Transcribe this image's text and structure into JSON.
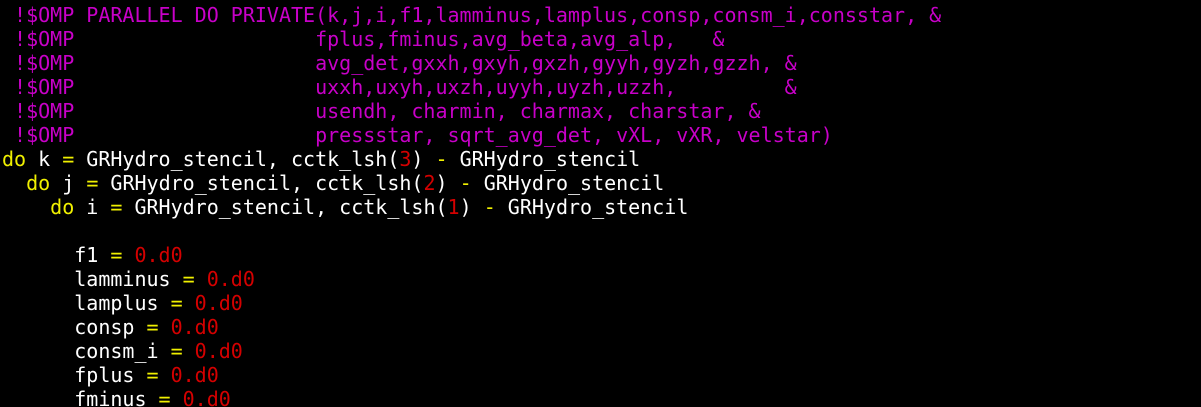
{
  "colors": {
    "background": "#000000",
    "comment": "#c800c8",
    "keyword": "#f0f000",
    "operator": "#f0f000",
    "text": "#ffffff",
    "number": "#d40000"
  },
  "lines": [
    [
      {
        "text": " !$OMP PARALLEL DO PRIVATE(k,j,i,f1,lamminus,lamplus,consp,consm_i,consstar, &",
        "role": "comment"
      }
    ],
    [
      {
        "text": " !$OMP                    fplus,fminus,avg_beta,avg_alp,   &",
        "role": "comment"
      }
    ],
    [
      {
        "text": " !$OMP                    avg_det,gxxh,gxyh,gxzh,gyyh,gyzh,gzzh, &",
        "role": "comment"
      }
    ],
    [
      {
        "text": " !$OMP                    uxxh,uxyh,uxzh,uyyh,uyzh,uzzh,         &",
        "role": "comment"
      }
    ],
    [
      {
        "text": " !$OMP                    usendh, charmin, charmax, charstar, &",
        "role": "comment"
      }
    ],
    [
      {
        "text": " !$OMP                    pressstar, sqrt_avg_det, vXL, vXR, velstar)",
        "role": "comment"
      }
    ],
    [
      {
        "text": "do",
        "role": "keyword"
      },
      {
        "text": " k ",
        "role": "text"
      },
      {
        "text": "=",
        "role": "operator"
      },
      {
        "text": " GRHydro_stencil, cctk_lsh(",
        "role": "text"
      },
      {
        "text": "3",
        "role": "number"
      },
      {
        "text": ") ",
        "role": "text"
      },
      {
        "text": "-",
        "role": "operator"
      },
      {
        "text": " GRHydro_stencil",
        "role": "text"
      }
    ],
    [
      {
        "text": "  ",
        "role": "text"
      },
      {
        "text": "do",
        "role": "keyword"
      },
      {
        "text": " j ",
        "role": "text"
      },
      {
        "text": "=",
        "role": "operator"
      },
      {
        "text": " GRHydro_stencil, cctk_lsh(",
        "role": "text"
      },
      {
        "text": "2",
        "role": "number"
      },
      {
        "text": ") ",
        "role": "text"
      },
      {
        "text": "-",
        "role": "operator"
      },
      {
        "text": " GRHydro_stencil",
        "role": "text"
      }
    ],
    [
      {
        "text": "    ",
        "role": "text"
      },
      {
        "text": "do",
        "role": "keyword"
      },
      {
        "text": " i ",
        "role": "text"
      },
      {
        "text": "=",
        "role": "operator"
      },
      {
        "text": " GRHydro_stencil, cctk_lsh(",
        "role": "text"
      },
      {
        "text": "1",
        "role": "number"
      },
      {
        "text": ") ",
        "role": "text"
      },
      {
        "text": "-",
        "role": "operator"
      },
      {
        "text": " GRHydro_stencil",
        "role": "text"
      }
    ],
    [],
    [
      {
        "text": "      f1 ",
        "role": "text"
      },
      {
        "text": "=",
        "role": "operator"
      },
      {
        "text": " ",
        "role": "text"
      },
      {
        "text": "0.d0",
        "role": "number"
      }
    ],
    [
      {
        "text": "      lamminus ",
        "role": "text"
      },
      {
        "text": "=",
        "role": "operator"
      },
      {
        "text": " ",
        "role": "text"
      },
      {
        "text": "0.d0",
        "role": "number"
      }
    ],
    [
      {
        "text": "      lamplus ",
        "role": "text"
      },
      {
        "text": "=",
        "role": "operator"
      },
      {
        "text": " ",
        "role": "text"
      },
      {
        "text": "0.d0",
        "role": "number"
      }
    ],
    [
      {
        "text": "      consp ",
        "role": "text"
      },
      {
        "text": "=",
        "role": "operator"
      },
      {
        "text": " ",
        "role": "text"
      },
      {
        "text": "0.d0",
        "role": "number"
      }
    ],
    [
      {
        "text": "      consm_i ",
        "role": "text"
      },
      {
        "text": "=",
        "role": "operator"
      },
      {
        "text": " ",
        "role": "text"
      },
      {
        "text": "0.d0",
        "role": "number"
      }
    ],
    [
      {
        "text": "      fplus ",
        "role": "text"
      },
      {
        "text": "=",
        "role": "operator"
      },
      {
        "text": " ",
        "role": "text"
      },
      {
        "text": "0.d0",
        "role": "number"
      }
    ],
    [
      {
        "text": "      fminus ",
        "role": "text"
      },
      {
        "text": "=",
        "role": "operator"
      },
      {
        "text": " ",
        "role": "text"
      },
      {
        "text": "0.d0",
        "role": "number"
      }
    ]
  ]
}
